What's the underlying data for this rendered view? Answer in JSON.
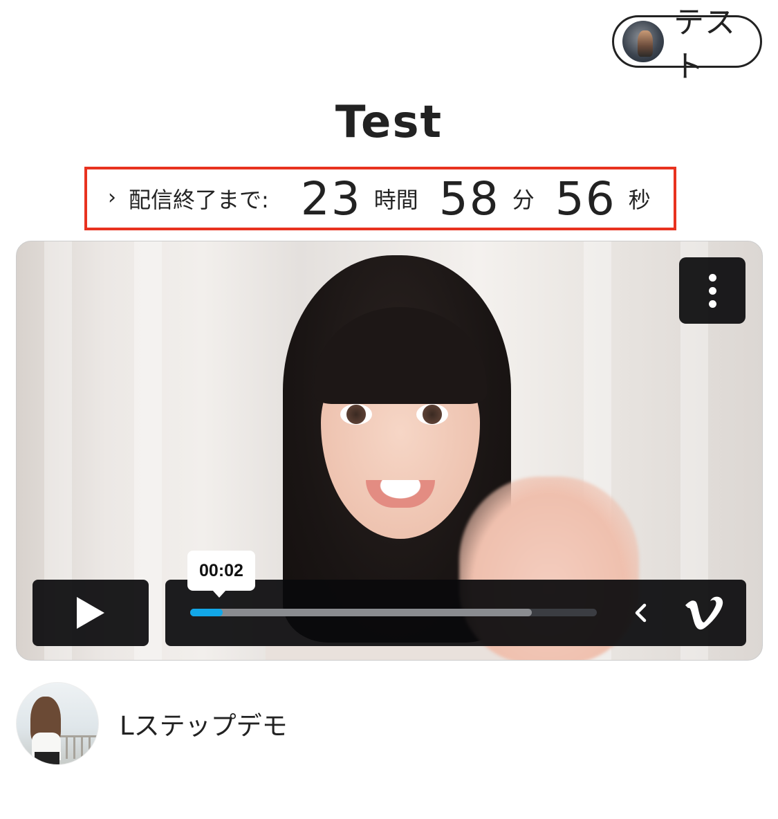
{
  "header": {
    "user_label": "テスト",
    "avatar_icon": "user-avatar"
  },
  "title": "Test",
  "countdown": {
    "label": "配信終了まで:",
    "hours": "23",
    "hours_unit": "時間",
    "minutes": "58",
    "minutes_unit": "分",
    "seconds": "56",
    "seconds_unit": "秒",
    "highlight_color": "#e8321f"
  },
  "player": {
    "current_time": "00:02",
    "played_fraction": 0.08,
    "buffered_fraction": 0.84,
    "progress_color": "#12a7e8",
    "icons": {
      "menu": "more-vertical-icon",
      "play": "play-icon",
      "collapse": "chevron-left-icon",
      "brand": "vimeo-icon"
    }
  },
  "channel": {
    "name": "Lステップデモ"
  }
}
